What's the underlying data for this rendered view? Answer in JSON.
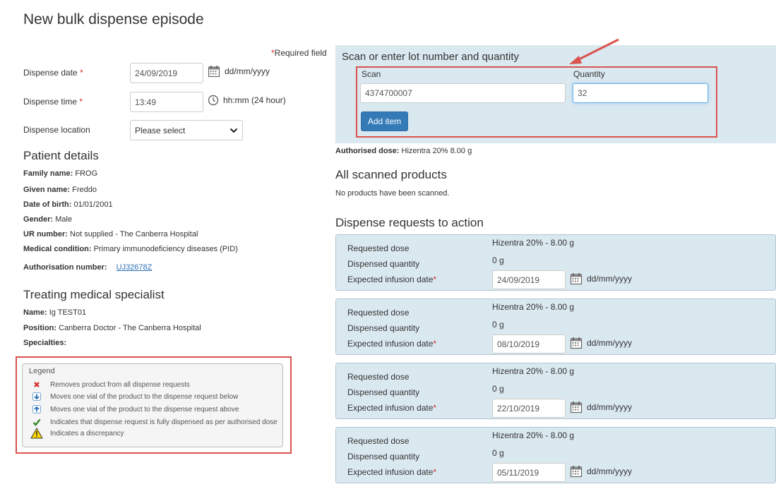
{
  "page": {
    "title": "New bulk dispense episode",
    "required_note": "Required field",
    "required_star": "*"
  },
  "form": {
    "dispense_date_label": "Dispense date",
    "dispense_date_value": "24/09/2019",
    "dispense_date_format": "dd/mm/yyyy",
    "dispense_time_label": "Dispense time",
    "dispense_time_value": "13:49",
    "dispense_time_format": "hh:mm (24 hour)",
    "dispense_location_label": "Dispense location",
    "dispense_location_value": "Please select"
  },
  "patient": {
    "heading": "Patient details",
    "fields": [
      {
        "label": "Family name:",
        "value": "FROG"
      },
      {
        "label": "Given name:",
        "value": "Freddo"
      },
      {
        "label": "Date of birth:",
        "value": "01/01/2001"
      },
      {
        "label": "Gender:",
        "value": "Male"
      },
      {
        "label": "UR number:",
        "value": "Not supplied - The Canberra Hospital"
      },
      {
        "label": "Medical condition:",
        "value": "Primary immunodeficiency diseases (PID)"
      }
    ],
    "authorisation_label": "Authorisation number:",
    "authorisation_value": "UJ32678Z"
  },
  "specialist": {
    "heading": "Treating medical specialist",
    "fields": [
      {
        "label": "Name:",
        "value": "Ig TEST01"
      },
      {
        "label": "Position:",
        "value": "Canberra Doctor - The Canberra Hospital"
      },
      {
        "label": "Specialties:",
        "value": ""
      }
    ]
  },
  "legend": {
    "title": "Legend",
    "items": [
      {
        "icon": "remove-x-icon",
        "text": "Removes product from all dispense requests"
      },
      {
        "icon": "move-down-icon",
        "text": "Moves one vial of the product to the dispense request below"
      },
      {
        "icon": "move-up-icon",
        "text": "Moves one vial of the product to the dispense request above"
      },
      {
        "icon": "checkmark-icon",
        "text": "Indicates that dispense request is fully dispensed as per authorised dose"
      },
      {
        "icon": "warning-icon",
        "text": "Indicates a discrepancy"
      }
    ]
  },
  "scan": {
    "heading": "Scan or enter lot number and quantity",
    "scan_label": "Scan",
    "scan_value": "4374700007",
    "quantity_label": "Quantity",
    "quantity_value": "32",
    "add_button": "Add item"
  },
  "authorised_dose": {
    "label": "Authorised dose:",
    "value": "Hizentra 20% 8.00 g"
  },
  "scanned": {
    "heading": "All scanned products",
    "empty_text": "No products have been scanned."
  },
  "requests": {
    "heading": "Dispense requests to action",
    "requested_dose_label": "Requested dose",
    "dispensed_quantity_label": "Dispensed quantity",
    "expected_date_label": "Expected infusion date",
    "date_format": "dd/mm/yyyy",
    "items": [
      {
        "dose": "Hizentra 20% - 8.00 g",
        "quantity": "0 g",
        "date": "24/09/2019"
      },
      {
        "dose": "Hizentra 20% - 8.00 g",
        "quantity": "0 g",
        "date": "08/10/2019"
      },
      {
        "dose": "Hizentra 20% - 8.00 g",
        "quantity": "0 g",
        "date": "22/10/2019"
      },
      {
        "dose": "Hizentra 20% - 8.00 g",
        "quantity": "0 g",
        "date": "05/11/2019"
      }
    ]
  },
  "colors": {
    "panel_bg": "#dae8f0",
    "primary_button": "#337ab7",
    "required_red": "#d9302c",
    "highlight_red": "#d9534f",
    "link_blue": "#2a6fb6"
  }
}
